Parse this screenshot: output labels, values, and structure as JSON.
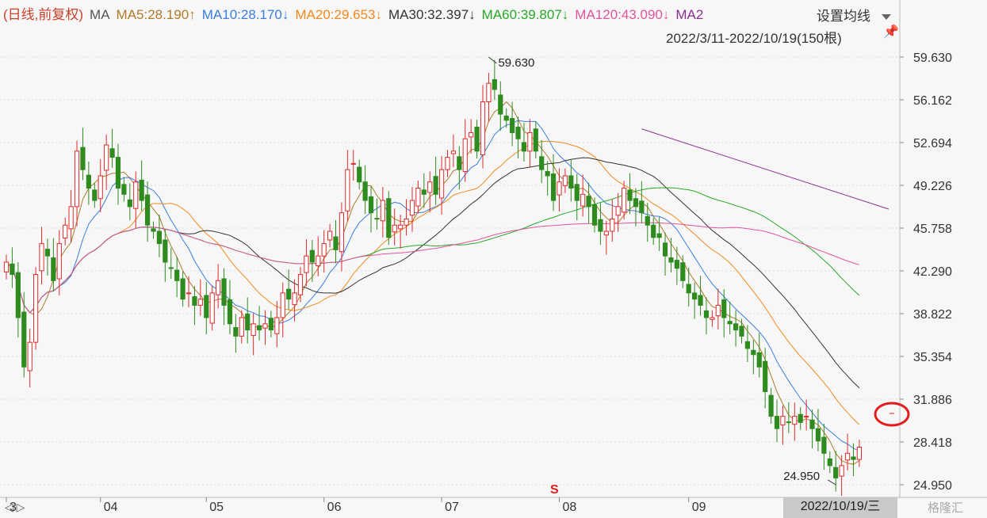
{
  "header": {
    "mode_label": "(日线,前复权)",
    "ma_label": "MA",
    "ma5": "MA5:28.190↑",
    "ma10": "MA10:28.170↓",
    "ma20": "MA20:29.653↓",
    "ma30": "MA30:32.397↓",
    "ma60": "MA60:39.807↓",
    "ma120": "MA120:43.090↓",
    "ma250": "MA2",
    "settings_label": "设置均线",
    "date_range": "2022/3/11-2022/10/19(150根)",
    "pin_icon": "pin-icon"
  },
  "footer": {
    "nav_icon": "◁ ▷",
    "cursor_date": "2022/10/19/三",
    "watermark": "格隆汇"
  },
  "colors": {
    "up": "#e0292b",
    "down": "#2e8b1e",
    "ma5": "#b07a2a",
    "ma10": "#3a7de0",
    "ma20": "#f08a1e",
    "ma30": "#333333",
    "ma60": "#28a828",
    "ma120": "#e0559b",
    "ma250": "#8b2f8f"
  },
  "chart_data": {
    "type": "candlestick",
    "title": "(日线,前复权)",
    "date_range": "2022/3/11-2022/10/19",
    "bar_count": 150,
    "y_ticks": [
      59.63,
      56.162,
      52.694,
      49.226,
      45.758,
      42.29,
      38.822,
      35.354,
      31.886,
      28.418,
      24.95
    ],
    "ylim": [
      24.95,
      59.63
    ],
    "x_ticks": [
      {
        "label": "3",
        "index": 0
      },
      {
        "label": "04",
        "index": 16
      },
      {
        "label": "05",
        "index": 34
      },
      {
        "label": "06",
        "index": 54
      },
      {
        "label": "07",
        "index": 74
      },
      {
        "label": "08",
        "index": 94
      },
      {
        "label": "09",
        "index": 116
      },
      {
        "label": "10",
        "index": 136
      }
    ],
    "annotations": [
      {
        "text": "59.630",
        "index": 82,
        "value": 59.63,
        "kind": "high"
      },
      {
        "text": "24.950",
        "index": 141,
        "value": 24.95,
        "kind": "low"
      }
    ],
    "ma_legend": [
      {
        "name": "MA5",
        "value": 28.19,
        "dir": "↑"
      },
      {
        "name": "MA10",
        "value": 28.17,
        "dir": "↓"
      },
      {
        "name": "MA20",
        "value": 29.653,
        "dir": "↓"
      },
      {
        "name": "MA30",
        "value": 32.397,
        "dir": "↓"
      },
      {
        "name": "MA60",
        "value": 39.807,
        "dir": "↓"
      },
      {
        "name": "MA120",
        "value": 43.09,
        "dir": "↓"
      }
    ],
    "close": [
      43.0,
      42.0,
      38.5,
      34.5,
      36.5,
      42.0,
      44.5,
      43.5,
      41.5,
      44.5,
      46.0,
      47.5,
      52.0,
      50.5,
      49.0,
      48.0,
      50.0,
      52.5,
      51.5,
      49.0,
      48.5,
      47.5,
      49.5,
      48.0,
      46.0,
      45.5,
      44.5,
      43.0,
      42.5,
      41.5,
      40.0,
      40.5,
      39.5,
      40.0,
      38.5,
      40.5,
      41.5,
      39.5,
      38.0,
      37.0,
      38.5,
      37.5,
      38.0,
      37.5,
      38.0,
      37.5,
      38.5,
      40.5,
      40.0,
      40.5,
      42.0,
      43.5,
      43.0,
      43.5,
      44.5,
      45.5,
      44.0,
      47.0,
      50.5,
      51.0,
      49.5,
      48.0,
      47.0,
      46.5,
      48.0,
      45.0,
      46.0,
      46.0,
      46.5,
      48.0,
      49.0,
      48.5,
      49.5,
      48.5,
      50.5,
      51.5,
      52.0,
      50.5,
      53.0,
      53.5,
      52.0,
      56.0,
      57.5,
      57.0,
      55.0,
      54.5,
      53.5,
      53.0,
      52.0,
      53.5,
      52.0,
      50.5,
      50.0,
      48.0,
      49.5,
      50.0,
      49.0,
      48.0,
      48.5,
      47.5,
      46.0,
      45.5,
      45.5,
      46.5,
      47.5,
      49.0,
      48.0,
      47.5,
      47.0,
      46.0,
      45.0,
      45.0,
      43.5,
      43.0,
      42.5,
      41.5,
      40.5,
      40.0,
      39.5,
      38.5,
      38.5,
      39.5,
      38.5,
      38.0,
      37.5,
      37.0,
      36.0,
      35.5,
      34.5,
      32.5,
      30.5,
      29.5,
      30.5,
      30.0,
      30.5,
      30.0,
      30.5,
      29.5,
      28.5,
      27.5,
      26.5,
      25.5,
      26.5,
      27.5,
      27.0,
      28.0
    ]
  }
}
